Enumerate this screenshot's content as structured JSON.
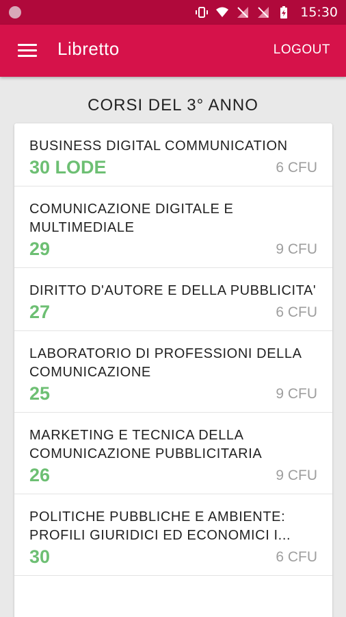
{
  "status_bar": {
    "time": "15:30"
  },
  "app_bar": {
    "title": "Libretto",
    "logout_label": "LOGOUT"
  },
  "section": {
    "title": "CORSI DEL 3° ANNO"
  },
  "courses": [
    {
      "name": "BUSINESS DIGITAL COMMUNICATION",
      "grade": "30 LODE",
      "cfu": "6 CFU"
    },
    {
      "name": "COMUNICAZIONE DIGITALE E MULTIMEDIALE",
      "grade": "29",
      "cfu": "9 CFU"
    },
    {
      "name": "DIRITTO D'AUTORE E DELLA PUBBLICITA'",
      "grade": "27",
      "cfu": "6 CFU"
    },
    {
      "name": "LABORATORIO DI PROFESSIONI DELLA COMUNICAZIONE",
      "grade": "25",
      "cfu": "9 CFU"
    },
    {
      "name": "MARKETING E TECNICA DELLA COMUNICAZIONE PUBBLICITARIA",
      "grade": "26",
      "cfu": "9 CFU"
    },
    {
      "name": "POLITICHE PUBBLICHE E AMBIENTE: PROFILI GIURIDICI ED ECONOMICI I...",
      "grade": "30",
      "cfu": "6 CFU"
    }
  ],
  "colors": {
    "status_bar": "#b0093b",
    "app_bar": "#d6124a",
    "grade": "#6dbf73",
    "cfu": "#9e9e9e"
  }
}
